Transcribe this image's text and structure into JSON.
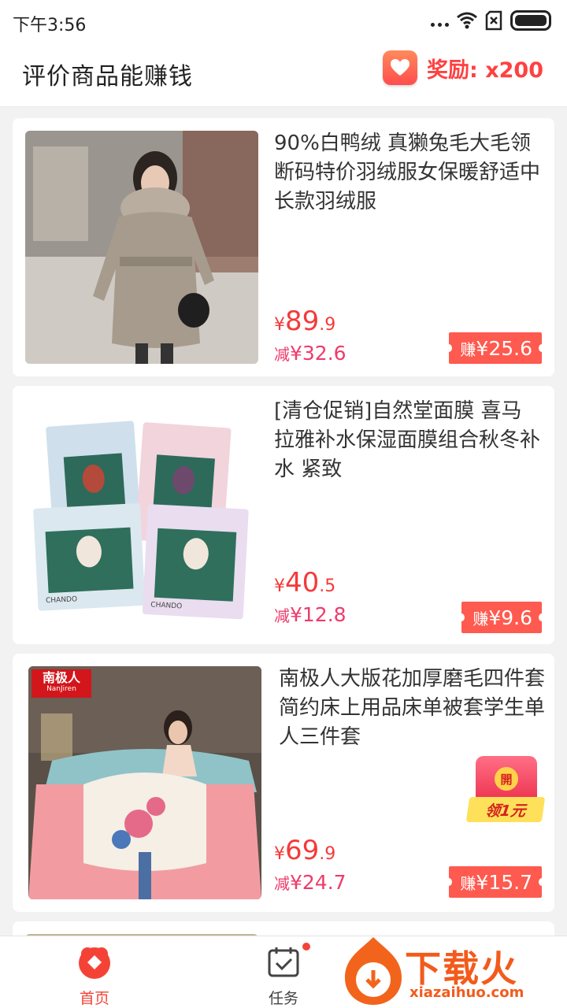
{
  "status_bar": {
    "time": "下午3:56"
  },
  "header": {
    "title": "评价商品能赚钱",
    "reward_text": "奖励: x200"
  },
  "products": [
    {
      "title": "90%白鸭绒  真獭兔毛大毛领断码特价羽绒服女保暖舒适中长款羽绒服",
      "price_symbol": "¥",
      "price_int": "89",
      "price_dec": ".9",
      "discount_label": "减",
      "discount_value": "¥32.6",
      "earn_label": "赚",
      "earn_value": "¥25.6"
    },
    {
      "title": "[清仓促销]自然堂面膜  喜马拉雅补水保湿面膜组合秋冬补水 紧致",
      "price_symbol": "¥",
      "price_int": "40",
      "price_dec": ".5",
      "discount_label": "减",
      "discount_value": "¥12.8",
      "earn_label": "赚",
      "earn_value": "¥9.6",
      "image_brand": "CHANDO"
    },
    {
      "title": "南极人大版花加厚磨毛四件套简约床上用品床单被套学生单人三件套",
      "price_symbol": "¥",
      "price_int": "69",
      "price_dec": ".9",
      "discount_label": "减",
      "discount_value": "¥24.7",
      "earn_label": "赚",
      "earn_value": "¥15.7",
      "brand_badge": "南极人",
      "brand_badge_sub": "NanJiren",
      "redpacket": {
        "seal": "開",
        "label": "领1元"
      }
    }
  ],
  "bottom_nav": [
    {
      "label": "首页",
      "icon": "home-icon",
      "active": true
    },
    {
      "label": "任务",
      "icon": "task-icon",
      "active": false
    }
  ],
  "watermark": {
    "text": "下载火",
    "url": "xiazaihuo.com"
  },
  "colors": {
    "accent": "#f44336",
    "price": "#f43a3a",
    "earn_bg": "#ff5a4f",
    "discount": "#ee3b6b"
  }
}
